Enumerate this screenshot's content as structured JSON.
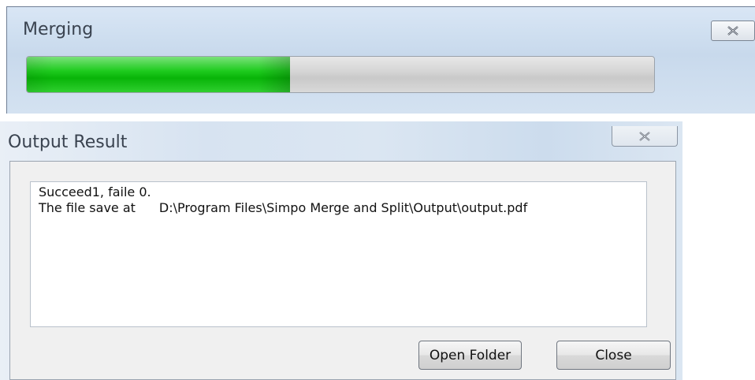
{
  "merging": {
    "title": "Merging",
    "progress_fraction": 0.42,
    "close_icon": "close-icon"
  },
  "output_result": {
    "title": "Output Result",
    "close_icon": "close-icon",
    "lines": {
      "status": "Succeed1, faile 0.",
      "save_label": "The file save at",
      "save_path": "D:\\Program Files\\Simpo Merge and Split\\Output\\output.pdf"
    },
    "buttons": {
      "open_folder": "Open Folder",
      "close": "Close"
    }
  },
  "colors": {
    "progress_green": "#08b408",
    "titlebar_blue": "#cfdff0"
  }
}
